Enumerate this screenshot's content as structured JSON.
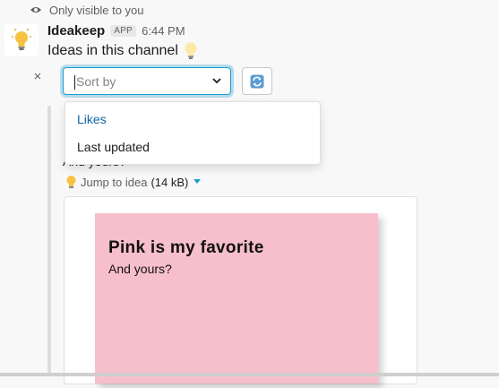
{
  "visibility": {
    "text": "Only visible to you",
    "icon": "eye-icon"
  },
  "message": {
    "app_name": "Ideakeep",
    "badge": "APP",
    "timestamp": "6:44 PM",
    "text": "Ideas in this channel",
    "emoji_icon": "lightbulb-icon"
  },
  "controls": {
    "close_label": "×",
    "sort_placeholder": "Sort by",
    "refresh_icon": "refresh-icon"
  },
  "dropdown": {
    "options": [
      "Likes",
      "Last updated"
    ],
    "highlighted": "Likes"
  },
  "obscured_text": "And yours?",
  "attachment": {
    "jump_label": "Jump to idea",
    "size": "(14 kB)"
  },
  "note": {
    "title": "Pink is my favorite",
    "body": "And yours?",
    "color": "#f7bfcc"
  },
  "colors": {
    "accent": "#1d9bd1",
    "link": "#1264a3"
  }
}
